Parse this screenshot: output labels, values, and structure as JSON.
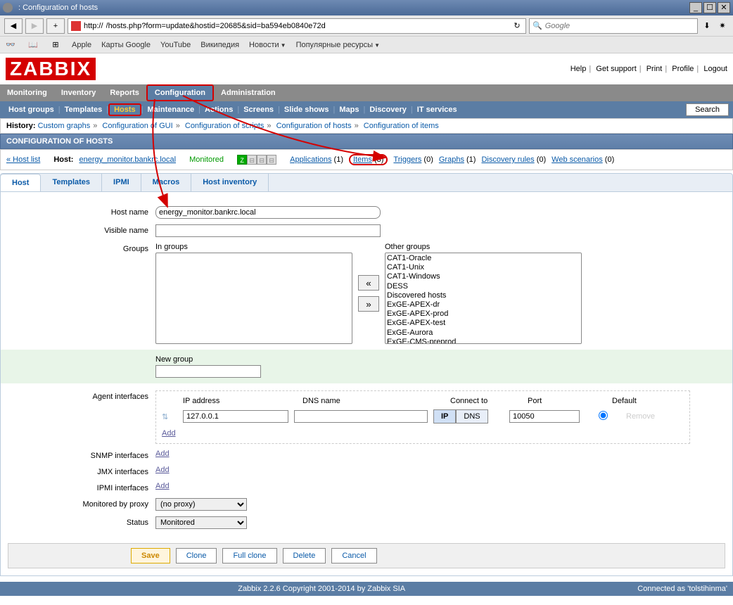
{
  "window_title": ": Configuration of hosts",
  "url": "/hosts.php?form=update&hostid=20685&sid=ba594eb0840e72d",
  "url_prefix": "http://",
  "search_placeholder": "Google",
  "bookmarks": [
    "Apple",
    "Карты Google",
    "YouTube",
    "Википедия",
    "Новости",
    "Популярные ресурсы"
  ],
  "logo": "ZABBIX",
  "header_links": [
    "Help",
    "Get support",
    "Print",
    "Profile",
    "Logout"
  ],
  "main_nav": [
    "Monitoring",
    "Inventory",
    "Reports",
    "Configuration",
    "Administration"
  ],
  "main_nav_active": "Configuration",
  "sub_nav": [
    "Host groups",
    "Templates",
    "Hosts",
    "Maintenance",
    "Actions",
    "Screens",
    "Slide shows",
    "Maps",
    "Discovery",
    "IT services"
  ],
  "sub_nav_active": "Hosts",
  "search_btn": "Search",
  "history_label": "History:",
  "history": [
    "Custom graphs",
    "Configuration of GUI",
    "Configuration of scripts",
    "Configuration of hosts",
    "Configuration of items"
  ],
  "section_title": "CONFIGURATION OF HOSTS",
  "host_list_link": "« Host list",
  "host_label": "Host:",
  "host_name_link": "energy_monitor.bankrc.local",
  "host_status": "Monitored",
  "host_links": [
    {
      "label": "Applications",
      "count": "(1)"
    },
    {
      "label": "Items",
      "count": "(3)"
    },
    {
      "label": "Triggers",
      "count": "(0)"
    },
    {
      "label": "Graphs",
      "count": "(1)"
    },
    {
      "label": "Discovery rules",
      "count": "(0)"
    },
    {
      "label": "Web scenarios",
      "count": "(0)"
    }
  ],
  "form_tabs": [
    "Host",
    "Templates",
    "IPMI",
    "Macros",
    "Host inventory"
  ],
  "form_tabs_active": "Host",
  "labels": {
    "host_name": "Host name",
    "visible_name": "Visible name",
    "groups": "Groups",
    "in_groups": "In groups",
    "other_groups": "Other groups",
    "new_group": "New group",
    "agent_if": "Agent interfaces",
    "snmp_if": "SNMP interfaces",
    "jmx_if": "JMX interfaces",
    "ipmi_if": "IPMI interfaces",
    "proxy": "Monitored by proxy",
    "status": "Status",
    "ip_address": "IP address",
    "dns_name": "DNS name",
    "connect_to": "Connect to",
    "port": "Port",
    "default": "Default",
    "add": "Add",
    "remove": "Remove",
    "ip": "IP",
    "dns": "DNS"
  },
  "values": {
    "host_name": "energy_monitor.bankrc.local",
    "visible_name": "",
    "new_group": "",
    "ip": "127.0.0.1",
    "dns": "",
    "port": "10050",
    "proxy": "(no proxy)",
    "status": "Monitored"
  },
  "other_groups": [
    "CAT1-Oracle",
    "CAT1-Unix",
    "CAT1-Windows",
    "DESS",
    "Discovered hosts",
    "ExGE-APEX-dr",
    "ExGE-APEX-prod",
    "ExGE-APEX-test",
    "ExGE-Aurora",
    "ExGE-CMS-preprod"
  ],
  "actions": {
    "save": "Save",
    "clone": "Clone",
    "full_clone": "Full clone",
    "delete": "Delete",
    "cancel": "Cancel"
  },
  "footer_text": "Zabbix 2.2.6 Copyright 2001-2014 by Zabbix SIA",
  "footer_user": "Connected as 'tolstihinma'"
}
